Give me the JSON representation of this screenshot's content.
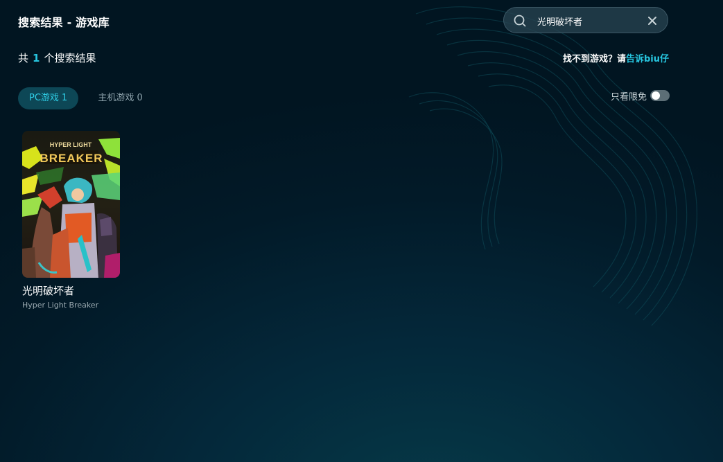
{
  "header": {
    "title": "搜索结果 - 游戏库"
  },
  "search": {
    "value": "光明破坏者",
    "placeholder": ""
  },
  "results": {
    "prefix": "共",
    "count": "1",
    "suffix": "个搜索结果"
  },
  "feedback": {
    "text": "找不到游戏？请",
    "link": "告诉biu仔"
  },
  "tabs": [
    {
      "label": "PC游戏 1",
      "active": true
    },
    {
      "label": "主机游戏 0",
      "active": false
    }
  ],
  "filter": {
    "label": "只看限免",
    "enabled": false
  },
  "games": [
    {
      "title": "光明破坏者",
      "subtitle": "Hyper Light Breaker",
      "cover_text_top": "HYPER LIGHT",
      "cover_text_main": "BREAKER"
    }
  ],
  "colors": {
    "accent": "#27c6e0",
    "tab_active_bg": "#0d4756",
    "background": "#021a28"
  }
}
